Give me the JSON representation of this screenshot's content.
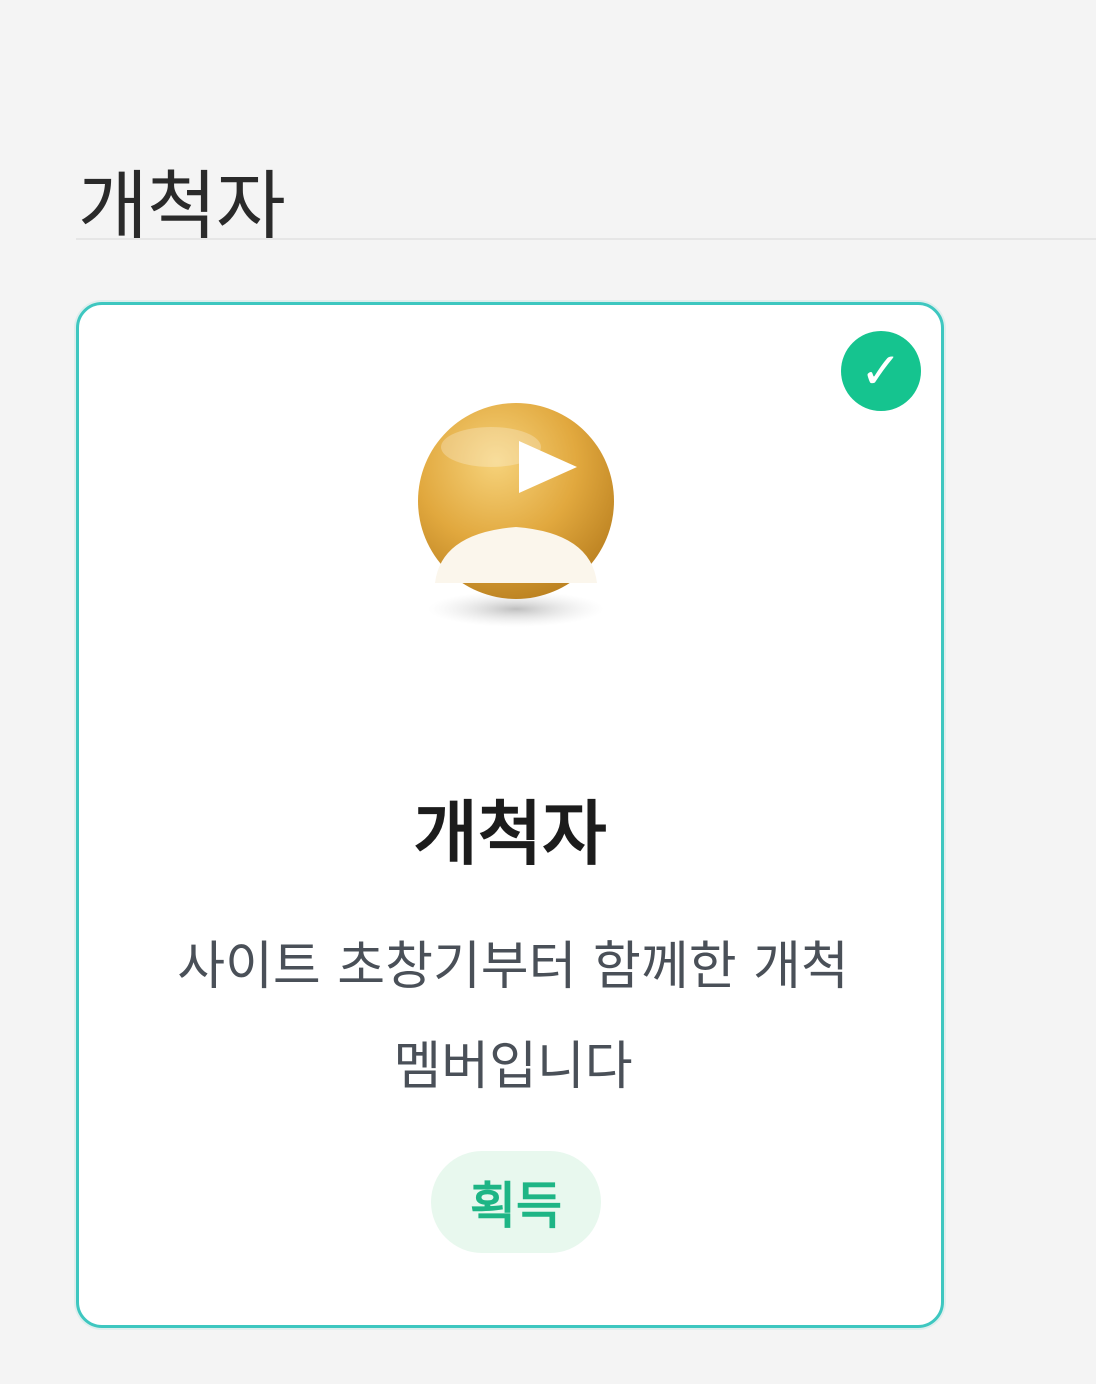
{
  "section": {
    "title": "개척자"
  },
  "card": {
    "title": "개척자",
    "description": "사이트 초창기부터 함께한 개척 멤버입니다",
    "status": "획득",
    "check_icon": "check-circle-icon",
    "badge_icon": "pioneer-badge-icon"
  },
  "colors": {
    "accent_border": "#3ec7c0",
    "check_bg": "#15c48f",
    "status_text": "#1eb585",
    "status_bg": "#e8f8ee",
    "badge_gold": "#e0a83a"
  }
}
